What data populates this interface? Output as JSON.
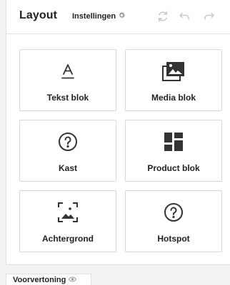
{
  "header": {
    "title": "Layout",
    "settings_label": "Instellingen",
    "icons": [
      "gear-icon",
      "refresh-icon",
      "undo-icon",
      "redo-icon"
    ]
  },
  "blocks": [
    {
      "label": "Tekst blok",
      "icon": "text-icon"
    },
    {
      "label": "Media blok",
      "icon": "media-images-icon"
    },
    {
      "label": "Kast",
      "icon": "question-circle-icon"
    },
    {
      "label": "Product blok",
      "icon": "grid-layout-icon"
    },
    {
      "label": "Achtergrond",
      "icon": "background-image-icon"
    },
    {
      "label": "Hotspot",
      "icon": "question-circle-icon"
    }
  ],
  "footer": {
    "preview_label": "Voorvertoning",
    "preview_icon": "eye-icon"
  },
  "colors": {
    "border": "#d8d8d8",
    "icon_dark": "#333333",
    "icon_muted": "#c8c8c8",
    "background": "#f3f3f3"
  }
}
